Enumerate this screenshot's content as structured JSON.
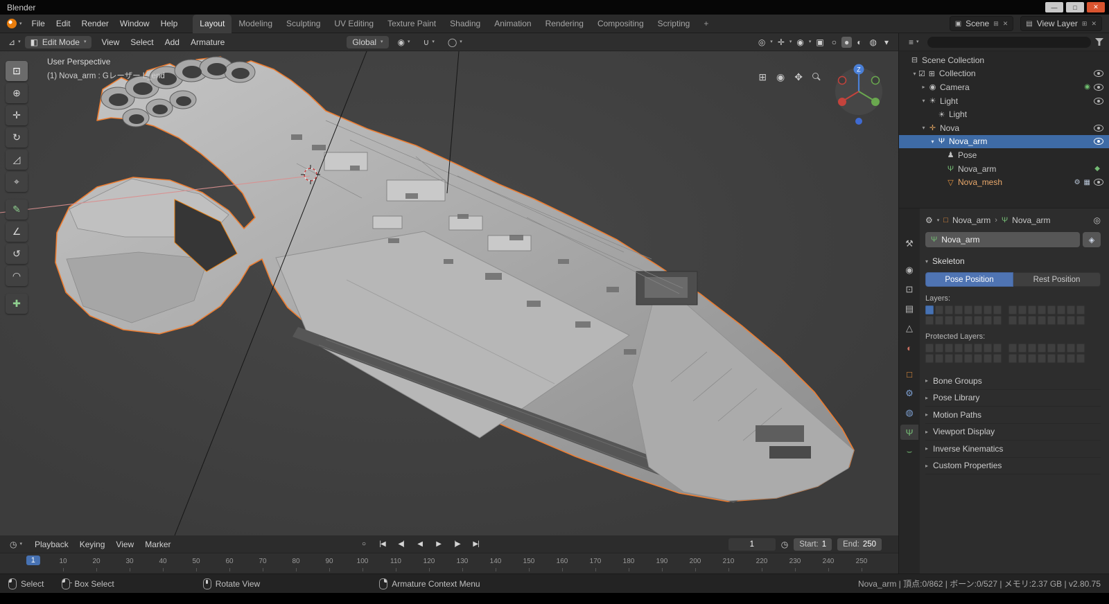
{
  "icons": {
    "chevron": "▾",
    "caret_open": "▾",
    "caret_closed": "▸",
    "checkbox": "☑",
    "separator": "›"
  },
  "colors": {
    "accent": "#4772b3",
    "selection": "#3e6ba6",
    "object_orange": "#e87d0d"
  },
  "window": {
    "title": "Blender",
    "minimize": "—",
    "maximize": "□",
    "close": "✕"
  },
  "topbar": {
    "menus": [
      "File",
      "Edit",
      "Render",
      "Window",
      "Help"
    ],
    "workspaces": [
      "Layout",
      "Modeling",
      "Sculpting",
      "UV Editing",
      "Texture Paint",
      "Shading",
      "Animation",
      "Rendering",
      "Compositing",
      "Scripting"
    ],
    "active_workspace": "Layout",
    "add_tab": "+",
    "scene": {
      "icon_glyph": "▣",
      "label": "Scene",
      "new_glyph": "⊞",
      "unlink_glyph": "✕"
    },
    "view_layer": {
      "icon_glyph": "▤",
      "label": "View Layer",
      "new_glyph": "⊞",
      "unlink_glyph": "✕"
    }
  },
  "viewport_header": {
    "editor_icon": "⊿",
    "mode_icon": "◧",
    "mode": "Edit Mode",
    "menus": [
      "View",
      "Select",
      "Add",
      "Armature"
    ],
    "orientation": "Global",
    "pivot_icon": "◉",
    "snap_icon": "∪",
    "proportional_icon": "◯",
    "right_icons": [
      {
        "name": "object-visibility-icon",
        "glyph": "◎",
        "chev": true
      },
      {
        "name": "gizmos-icon",
        "glyph": "✛",
        "chev": true
      },
      {
        "name": "overlays-icon",
        "glyph": "◉",
        "chev": true
      },
      {
        "name": "xray-toggle-icon",
        "glyph": "▣"
      },
      {
        "name": "shading-wireframe-icon",
        "glyph": "○"
      },
      {
        "name": "shading-solid-icon",
        "glyph": "●",
        "active": true
      },
      {
        "name": "shading-material-icon",
        "glyph": "◐"
      },
      {
        "name": "shading-rendered-icon",
        "glyph": "◍"
      },
      {
        "name": "shading-options-icon",
        "glyph": "▾"
      }
    ]
  },
  "viewport": {
    "view_label": "User Perspective",
    "object_label": "(1) Nova_arm : Gレーザー L_end",
    "gizmo_z": "Z"
  },
  "tools": [
    {
      "name": "select-box-tool",
      "glyph": "⊡",
      "active": true
    },
    {
      "name": "cursor-tool",
      "glyph": "⊕"
    },
    {
      "name": "move-tool",
      "glyph": "✛"
    },
    {
      "name": "rotate-tool",
      "glyph": "↻"
    },
    {
      "name": "scale-tool",
      "glyph": "◿"
    },
    {
      "name": "transform-tool",
      "glyph": "⌖"
    },
    {
      "name": "annotate-tool",
      "glyph": "✎",
      "color": "#8fcf8f"
    },
    {
      "name": "measure-tool",
      "glyph": "∠"
    },
    {
      "name": "roll-tool",
      "glyph": "↺"
    },
    {
      "name": "bone-envelope-tool",
      "glyph": "◠"
    },
    {
      "name": "extrude-bone-tool",
      "glyph": "✚",
      "color": "#8fcf8f"
    }
  ],
  "nav_icons": [
    {
      "name": "toggle-projection-icon",
      "glyph": "⊞"
    },
    {
      "name": "camera-view-icon",
      "glyph": "◉"
    },
    {
      "name": "pan-view-icon",
      "glyph": "✥"
    },
    {
      "name": "zoom-view-icon",
      "glyph": "lens"
    }
  ],
  "outliner": {
    "editor_icon": "≡",
    "rows": [
      {
        "label": "Scene Collection",
        "icon": "scene-collection-icon",
        "glyph": "⊟",
        "depth": 0
      },
      {
        "label": "Collection",
        "icon": "collection-icon",
        "glyph": "⊞",
        "depth": 1,
        "caret": "open",
        "checkbox": true,
        "eye": true
      },
      {
        "label": "Camera",
        "icon": "camera-icon",
        "glyph": "◉",
        "depth": 2,
        "caret": "closed",
        "badges": [
          {
            "name": "camera-data-icon",
            "glyph": "◉",
            "color": "#6fbf6f"
          }
        ],
        "eye": true
      },
      {
        "label": "Light",
        "icon": "light-icon",
        "glyph": "☀",
        "depth": 2,
        "caret": "open",
        "eye": true
      },
      {
        "label": "Light",
        "icon": "light-data-icon",
        "glyph": "☀",
        "depth": 3
      },
      {
        "label": "Nova",
        "icon": "empty-object-icon",
        "glyph": "✛",
        "color": "#dca05f",
        "depth": 2,
        "caret": "open",
        "eye": true
      },
      {
        "label": "Nova_arm",
        "icon": "armature-object-icon",
        "glyph": "Ψ",
        "depth": 3,
        "caret": "open",
        "selected": true,
        "eye": true
      },
      {
        "label": "Pose",
        "icon": "pose-icon",
        "glyph": "♟",
        "depth": 4
      },
      {
        "label": "Nova_arm",
        "icon": "armature-data-icon",
        "glyph": "Ψ",
        "color": "#74bb74",
        "depth": 4,
        "badges": [
          {
            "name": "bone-icon",
            "glyph": "◆",
            "color": "#74bb74"
          }
        ]
      },
      {
        "label": "Nova_mesh",
        "icon": "mesh-data-icon",
        "glyph": "▽",
        "color": "#e8953f",
        "label_color": "#e9a86b",
        "depth": 4,
        "badges": [
          {
            "name": "wrench-icon",
            "glyph": "⚙",
            "color": "#b9c6d8"
          },
          {
            "name": "modifier-icon",
            "glyph": "▦",
            "color": "#b9c6d8"
          }
        ],
        "eye": true
      }
    ]
  },
  "properties": {
    "editor_icon": "⚙",
    "tabs": [
      {
        "name": "tool",
        "glyph": "⚒",
        "color": "#b8b8b8"
      },
      {
        "name": "render",
        "glyph": "◉",
        "color": "#b8b8b8"
      },
      {
        "name": "output",
        "glyph": "⊡",
        "color": "#b8b8b8"
      },
      {
        "name": "view-layer",
        "glyph": "▤",
        "color": "#b8b8b8"
      },
      {
        "name": "scene",
        "glyph": "△",
        "color": "#b8b8b8"
      },
      {
        "name": "world",
        "glyph": "◐",
        "color": "#c96f5f"
      },
      {
        "name": "object",
        "glyph": "□",
        "color": "#e8913f"
      },
      {
        "name": "constraints",
        "glyph": "⚙",
        "color": "#7d9fd1"
      },
      {
        "name": "physics",
        "glyph": "◍",
        "color": "#7d9fd1"
      },
      {
        "name": "object-data",
        "glyph": "Ψ",
        "color": "#74bb74",
        "active": true
      },
      {
        "name": "bone",
        "glyph": "⌣",
        "color": "#74bb74"
      }
    ],
    "breadcrumb": {
      "object_icon": "□",
      "object": "Nova_arm",
      "data_icon": "Ψ",
      "data": "Nova_arm"
    },
    "pin_icon": "◎",
    "name_icon": "Ψ",
    "shield_icon": "◈",
    "name_value": "Nova_arm",
    "skeleton_title": "Skeleton",
    "pose_position": "Pose Position",
    "rest_position": "Rest Position",
    "layers_label": "Layers:",
    "protected_layers_label": "Protected Layers:",
    "layers_active": [
      0
    ],
    "protected_active": [],
    "panels": [
      "Bone Groups",
      "Pose Library",
      "Motion Paths",
      "Viewport Display",
      "Inverse Kinematics",
      "Custom Properties"
    ]
  },
  "timeline": {
    "editor_icon": "◷",
    "menus": [
      "Playback",
      "Keying",
      "View",
      "Marker"
    ],
    "transport": [
      {
        "name": "auto-key-record",
        "glyph": "○"
      },
      {
        "name": "jump-to-start",
        "glyph": "|◀"
      },
      {
        "name": "previous-keyframe",
        "glyph": "◀|"
      },
      {
        "name": "play-reverse",
        "glyph": "◀"
      },
      {
        "name": "play",
        "glyph": "▶"
      },
      {
        "name": "next-keyframe",
        "glyph": "|▶"
      },
      {
        "name": "jump-to-end",
        "glyph": "▶|"
      }
    ],
    "current_frame": "1",
    "clock_icon": "◷",
    "start_label": "Start:",
    "start_value": "1",
    "end_label": "End:",
    "end_value": "250",
    "marker_frame": "1",
    "ticks": [
      10,
      20,
      30,
      40,
      50,
      60,
      70,
      80,
      90,
      100,
      110,
      120,
      130,
      140,
      150,
      160,
      170,
      180,
      190,
      200,
      210,
      220,
      230,
      240,
      250
    ]
  },
  "statusbar": {
    "hints": [
      {
        "icon": "mouse-left-icon",
        "label": "Select"
      },
      {
        "icon": "mouse-drag-icon",
        "label": "Box Select"
      },
      {
        "icon": "mouse-middle-icon",
        "label": "Rotate View"
      },
      {
        "icon": "mouse-right-icon",
        "label": "Armature Context Menu"
      }
    ],
    "info": "Nova_arm | 頂点:0/862 | ボーン:0/527 | メモリ:2.37 GB | v2.80.75"
  }
}
